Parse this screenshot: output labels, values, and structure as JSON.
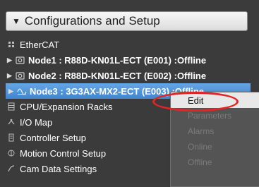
{
  "header": {
    "title": "Configurations and Setup",
    "toggle_glyph": "▼"
  },
  "tree": [
    {
      "label": "EtherCAT",
      "icon": "network-icon",
      "arrow": ""
    },
    {
      "label": "Node1 : R88D-KN01L-ECT (E001) : ",
      "status": "Offline",
      "icon": "servo-icon",
      "arrow": "▶"
    },
    {
      "label": "Node2 : R88D-KN01L-ECT (E002) : ",
      "status": "Offline",
      "icon": "servo-icon",
      "arrow": "▶"
    },
    {
      "label": "Node3 : 3G3AX-MX2-ECT (E003) : ",
      "status": "Offline",
      "icon": "inverter-icon",
      "arrow": "▶"
    },
    {
      "label": "CPU/Expansion Racks",
      "icon": "rack-icon",
      "arrow": ""
    },
    {
      "label": "I/O Map",
      "icon": "io-map-icon",
      "arrow": ""
    },
    {
      "label": "Controller Setup",
      "icon": "controller-icon",
      "arrow": ""
    },
    {
      "label": "Motion Control Setup",
      "icon": "motion-icon",
      "arrow": ""
    },
    {
      "label": "Cam Data Settings",
      "icon": "cam-icon",
      "arrow": ""
    }
  ],
  "context_menu": {
    "items": [
      "Edit",
      "Parameters",
      "Alarms",
      "Online",
      "Offline"
    ],
    "active": "Edit"
  },
  "colors": {
    "selection": "#4a90d9",
    "highlight_ring": "#e32525",
    "background": "#3b3b3b"
  }
}
